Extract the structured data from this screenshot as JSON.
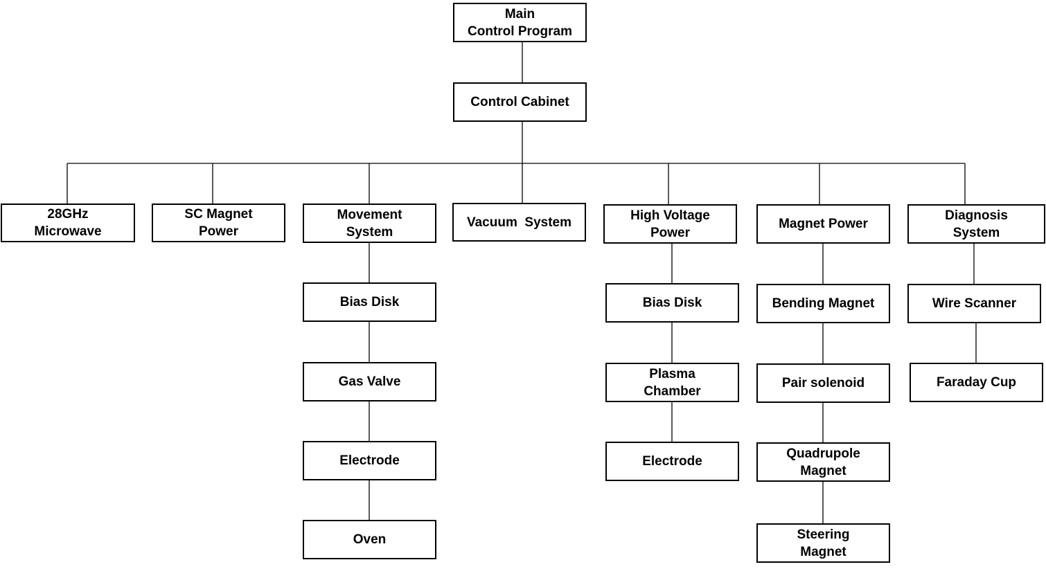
{
  "diagram": {
    "root": "Main\nControl Program",
    "cabinet": "Control Cabinet",
    "branches": [
      {
        "label": "28GHz\nMicrowave",
        "children": []
      },
      {
        "label": "SC Magnet\nPower",
        "children": []
      },
      {
        "label": "Movement\nSystem",
        "children": [
          "Bias Disk",
          "Gas Valve",
          "Electrode",
          "Oven"
        ]
      },
      {
        "label": "Vacuum  System",
        "children": []
      },
      {
        "label": "High Voltage\nPower",
        "children": [
          "Bias Disk",
          "Plasma\nChamber",
          "Electrode"
        ]
      },
      {
        "label": "Magnet Power",
        "children": [
          "Bending Magnet",
          "Pair solenoid",
          "Quadrupole\nMagnet",
          "Steering\nMagnet"
        ]
      },
      {
        "label": "Diagnosis\nSystem",
        "children": [
          "Wire Scanner",
          "Faraday Cup"
        ]
      }
    ]
  }
}
